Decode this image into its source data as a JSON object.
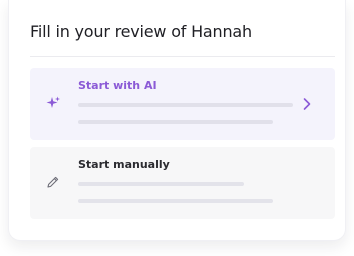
{
  "dialog": {
    "title": "Fill in your review of Hannah"
  },
  "options": {
    "ai": {
      "label": "Start with AI",
      "icon": "sparkles-icon",
      "accent": "#8b5ad6"
    },
    "manual": {
      "label": "Start manually",
      "icon": "pencil-icon"
    }
  }
}
